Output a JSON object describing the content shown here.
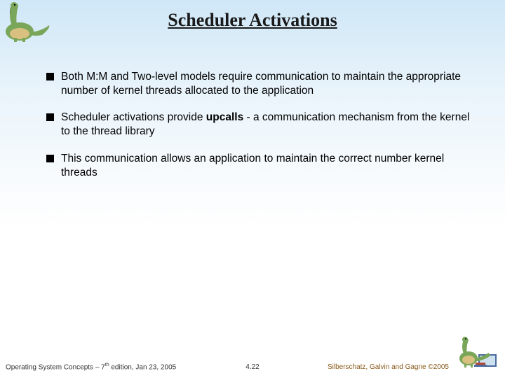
{
  "title": "Scheduler Activations",
  "bullets": [
    {
      "html": "Both M:M and Two-level models require communication to maintain the appropriate number of kernel threads allocated to the application"
    },
    {
      "html": "Scheduler activations provide <span class='bold'>upcalls</span> - a communication mechanism from the kernel to the thread library"
    },
    {
      "html": "This communication allows an application to maintain the correct number kernel threads"
    }
  ],
  "footer": {
    "left_html": "Operating System Concepts – 7<span class='sup'>th</span> edition, Jan 23, 2005",
    "center": "4.22",
    "right_html": "Silberschatz, Galvin and Gagne ©2005"
  },
  "colors": {
    "dino_body": "#7aa65a",
    "dino_belly": "#d9c080",
    "book_red": "#b5472f",
    "book_blue": "#4a6aa0"
  }
}
